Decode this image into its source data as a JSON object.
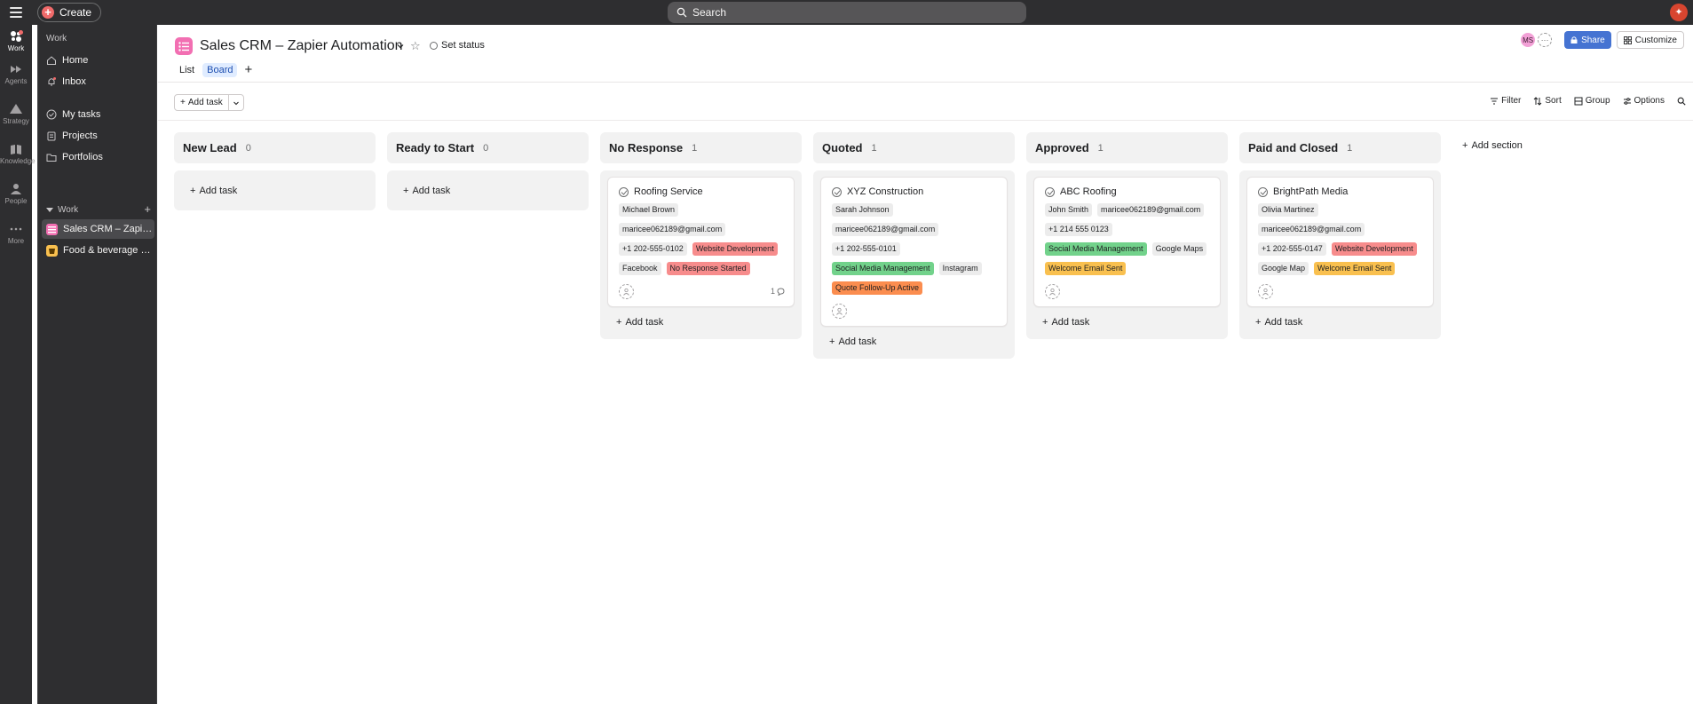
{
  "topbar": {
    "create_label": "Create",
    "search_placeholder": "Search"
  },
  "rail": {
    "items": [
      {
        "label": "Work"
      },
      {
        "label": "Agents"
      },
      {
        "label": "Strategy"
      },
      {
        "label": "Knowledge"
      },
      {
        "label": "People"
      },
      {
        "label": "More"
      }
    ]
  },
  "sidebar": {
    "heading": "Work",
    "nav": [
      {
        "label": "Home"
      },
      {
        "label": "Inbox"
      },
      {
        "label": "My tasks"
      },
      {
        "label": "Projects"
      },
      {
        "label": "Portfolios"
      }
    ],
    "work_section_label": "Work",
    "projects": [
      {
        "label": "Sales CRM – Zapier Automation",
        "color": "#f26fb2"
      },
      {
        "label": "Food & beverage business",
        "color": "#f9c04f"
      }
    ]
  },
  "header": {
    "project_title": "Sales CRM – Zapier Automation",
    "set_status": "Set status",
    "tabs": [
      {
        "label": "List"
      },
      {
        "label": "Board"
      }
    ],
    "avatar_initials": "MS",
    "share_label": "Share",
    "customize_label": "Customize"
  },
  "toolbar": {
    "add_task": "Add task",
    "filter": "Filter",
    "sort": "Sort",
    "group": "Group",
    "options": "Options"
  },
  "board": {
    "add_task_label": "Add task",
    "add_section_label": "Add section",
    "columns": [
      {
        "title": "New Lead",
        "count": "0",
        "cards": []
      },
      {
        "title": "Ready to Start",
        "count": "0",
        "cards": []
      },
      {
        "title": "No Response",
        "count": "1",
        "cards": [
          {
            "title": "Roofing Service",
            "chips": [
              {
                "text": "Michael Brown",
                "color": "gray"
              },
              {
                "text": "maricee062189@gmail.com",
                "color": "gray"
              },
              {
                "text": "+1 202-555-0102",
                "color": "gray"
              },
              {
                "text": "Website Development",
                "color": "red"
              },
              {
                "text": "Facebook",
                "color": "gray"
              },
              {
                "text": "No Response Started",
                "color": "red"
              }
            ],
            "comments": "1"
          }
        ]
      },
      {
        "title": "Quoted",
        "count": "1",
        "cards": [
          {
            "title": "XYZ Construction",
            "chips": [
              {
                "text": "Sarah Johnson",
                "color": "gray"
              },
              {
                "text": "maricee062189@gmail.com",
                "color": "gray"
              },
              {
                "text": "+1 202-555-0101",
                "color": "gray"
              },
              {
                "text": "Social Media Management",
                "color": "green"
              },
              {
                "text": "Instagram",
                "color": "gray"
              },
              {
                "text": "Quote Follow-Up Active",
                "color": "orange"
              }
            ],
            "comments": ""
          }
        ]
      },
      {
        "title": "Approved",
        "count": "1",
        "cards": [
          {
            "title": "ABC Roofing",
            "chips": [
              {
                "text": "John Smith",
                "color": "gray"
              },
              {
                "text": "maricee062189@gmail.com",
                "color": "gray"
              },
              {
                "text": "+1 214 555 0123",
                "color": "gray"
              },
              {
                "text": "Social Media Management",
                "color": "green"
              },
              {
                "text": "Google Maps",
                "color": "gray"
              },
              {
                "text": "Welcome Email Sent",
                "color": "yellow"
              }
            ],
            "comments": ""
          }
        ]
      },
      {
        "title": "Paid and Closed",
        "count": "1",
        "cards": [
          {
            "title": "BrightPath Media",
            "chips": [
              {
                "text": "Olivia Martinez",
                "color": "gray"
              },
              {
                "text": "maricee062189@gmail.com",
                "color": "gray"
              },
              {
                "text": "+1 202-555-0147",
                "color": "gray"
              },
              {
                "text": "Website Development",
                "color": "red"
              },
              {
                "text": "Google Map",
                "color": "gray"
              },
              {
                "text": "Welcome Email Sent",
                "color": "yellow"
              }
            ],
            "comments": ""
          }
        ]
      }
    ]
  },
  "colors": {
    "chrome": "#2e2e30",
    "accent": "#4573d2",
    "chip_red": "#f78c8c",
    "chip_green": "#72d28b",
    "chip_yellow": "#f9c04f",
    "chip_orange": "#fb8d4f"
  }
}
